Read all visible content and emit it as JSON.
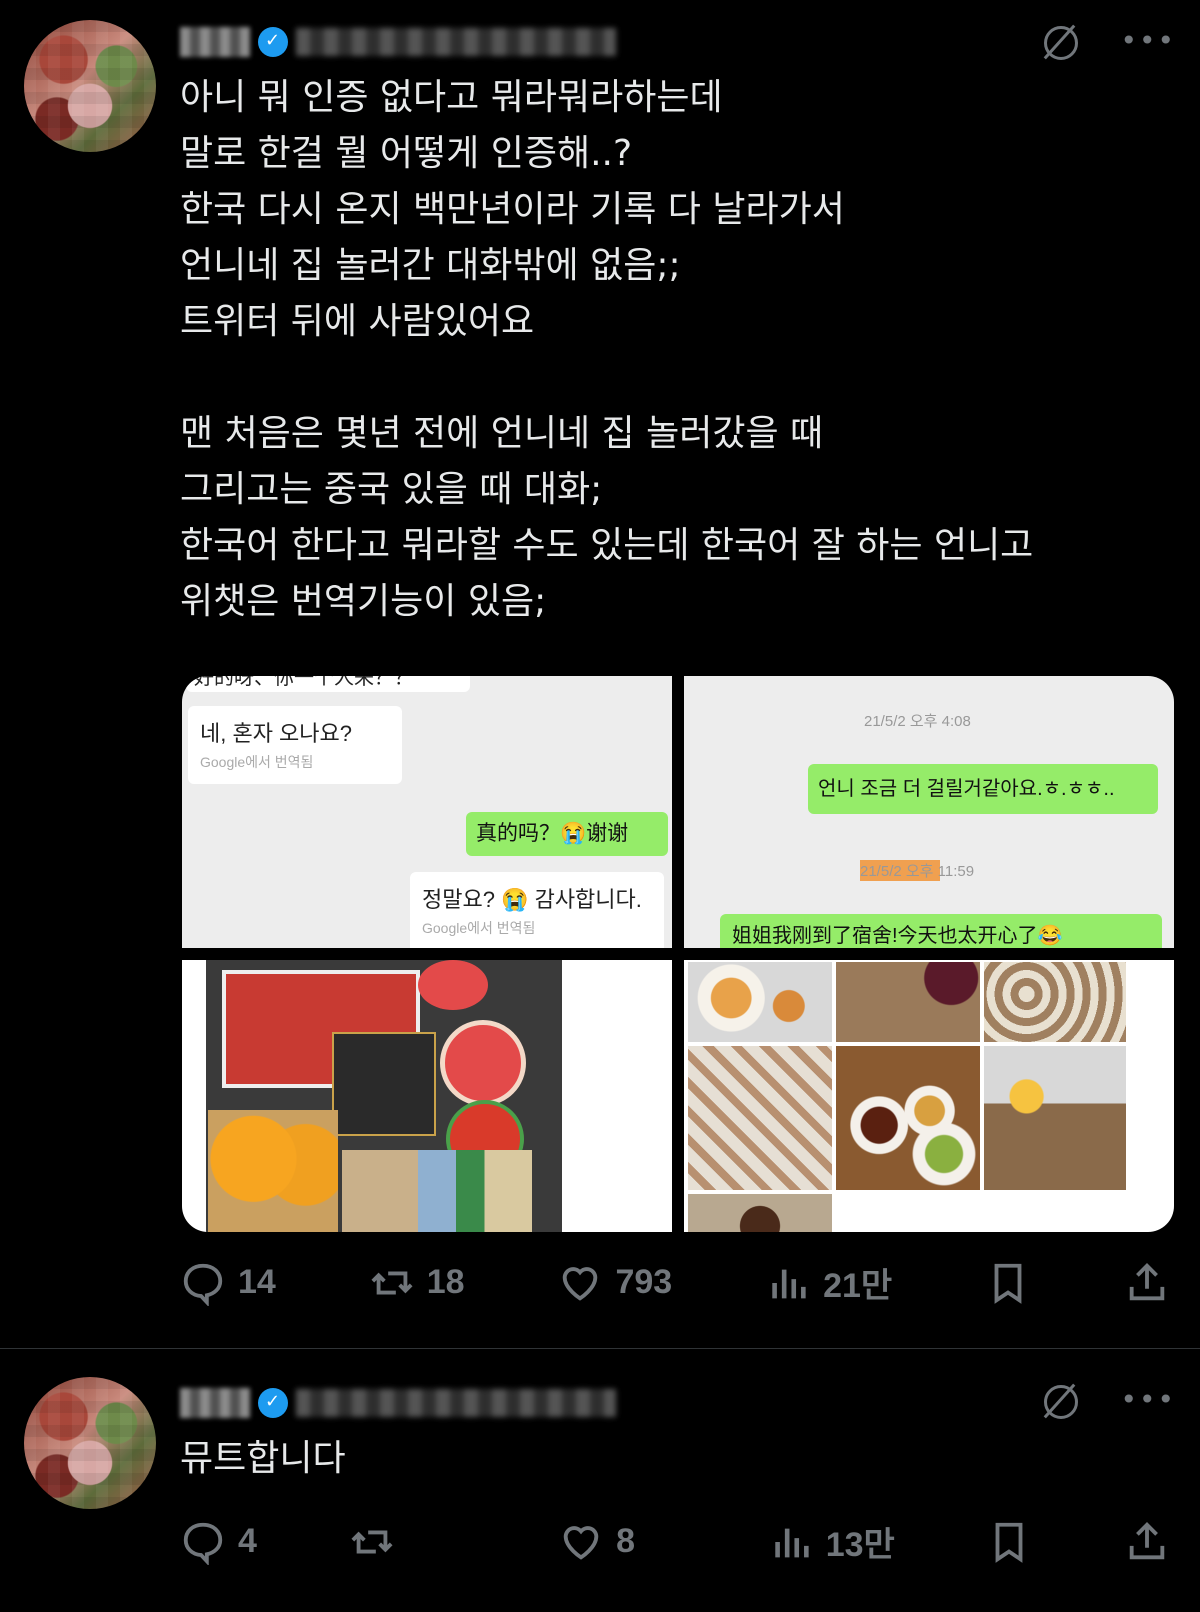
{
  "tweet1": {
    "text": "아니 뭐 인증 없다고 뭐라뭐라하는데\n말로 한걸 뭘 어떻게 인증해..?\n한국 다시 온지 백만년이라 기록 다 날라가서\n언니네 집 놀러간 대화밖에 없음;;\n트위터 뒤에 사람있어요\n\n맨 처음은 몇년 전에 언니네 집 놀러갔을 때\n그리고는 중국 있을 때 대화;\n한국어 한다고 뭐라할 수도 있는데 한국어 잘 하는 언니고\n위챗은 번역기능이 있음;",
    "chat1": {
      "top_cut": "好的呀、你一个人来？？",
      "bubble1": "네, 혼자 오나요?",
      "bubble1_trans": "Google에서 번역됨",
      "bubble2": "真的吗？😭谢谢",
      "bubble3": "정말요? 😭 감사합니다.",
      "bubble3_trans": "Google에서 번역됨"
    },
    "chat2": {
      "ts1": "21/5/2 오후 4:08",
      "bubble1": "언니 조금 더 걸릴거같아요.ㅎ.ㅎㅎ..",
      "ts2": "21/5/2 오후 11:59",
      "bubble2": "姐姐我刚到了宿舍!今天也太开心了😂"
    },
    "actions": {
      "replies": "14",
      "retweets": "18",
      "likes": "793",
      "views": "21만"
    }
  },
  "tweet2": {
    "text": "뮤트합니다",
    "actions": {
      "replies": "4",
      "retweets": "",
      "likes": "8",
      "views": "13만"
    }
  },
  "icons": [
    "grok-icon",
    "more-icon",
    "reply-icon",
    "retweet-icon",
    "like-icon",
    "views-icon",
    "bookmark-icon",
    "share-icon",
    "verified-icon"
  ],
  "colors": {
    "background": "#000000",
    "text": "#e7e9ea",
    "muted": "#71767b",
    "verified": "#1d9bf0",
    "wechat_green": "#95ec69"
  }
}
